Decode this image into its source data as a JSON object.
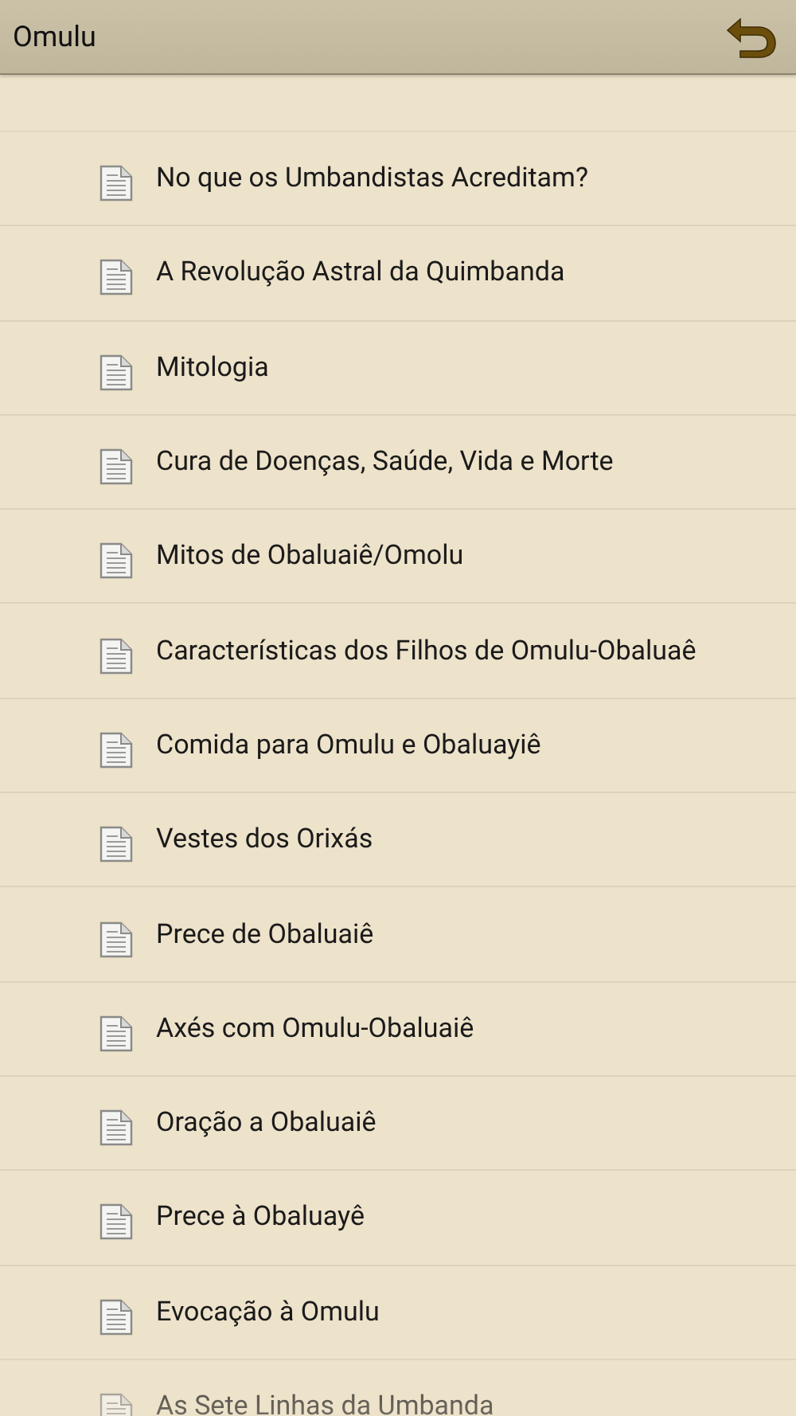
{
  "header": {
    "title": "Omulu"
  },
  "items": [
    {
      "label": "No que os Umbandistas Acreditam?"
    },
    {
      "label": "A Revolução Astral da Quimbanda"
    },
    {
      "label": "Mitologia"
    },
    {
      "label": "Cura de Doenças, Saúde, Vida e Morte"
    },
    {
      "label": "Mitos de Obaluaiê/Omolu"
    },
    {
      "label": "Características dos Filhos de Omulu-Obaluaê"
    },
    {
      "label": "Comida para Omulu e Obaluayiê"
    },
    {
      "label": "Vestes dos Orixás"
    },
    {
      "label": "Prece de Obaluaiê"
    },
    {
      "label": "Axés com Omulu-Obaluaiê"
    },
    {
      "label": "Oração a Obaluaiê"
    },
    {
      "label": "Prece à Obaluayê"
    },
    {
      "label": "Evocação à Omulu"
    },
    {
      "label": "As Sete Linhas da Umbanda"
    }
  ]
}
